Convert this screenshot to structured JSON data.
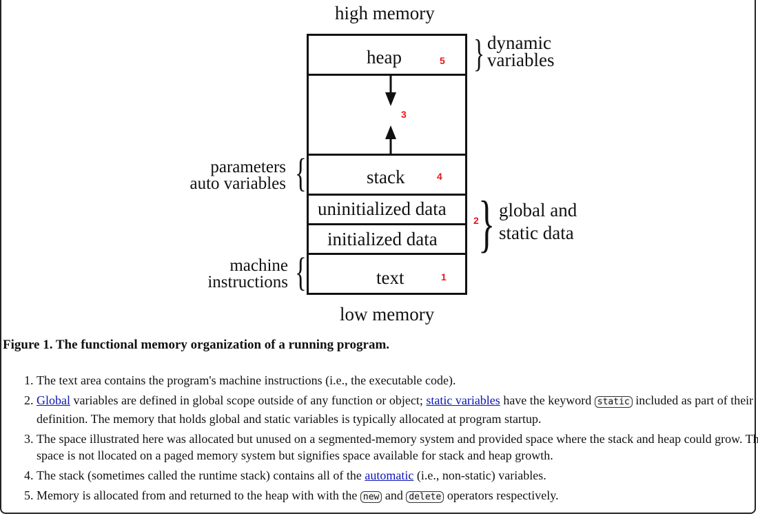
{
  "diagram": {
    "top_label": "high memory",
    "bottom_label": "low memory",
    "segments": [
      {
        "name": "heap",
        "number": "5"
      },
      {
        "name": "",
        "number": "3"
      },
      {
        "name": "stack",
        "number": "4"
      },
      {
        "name": "uninitialized data",
        "number": ""
      },
      {
        "name": "initialized data",
        "number": ""
      },
      {
        "name": "text",
        "number": "1"
      }
    ],
    "group_number_data": "2",
    "annotations": {
      "dynamic": [
        "dynamic",
        "variables"
      ],
      "params": [
        "parameters",
        "auto variables"
      ],
      "global": [
        "global and",
        "static data"
      ],
      "machine": [
        "machine",
        "instructions"
      ]
    }
  },
  "caption": "Figure 1. The functional memory organization of a running program.",
  "notes": [
    {
      "text": "The text area contains the program's machine instructions (i.e., the executable code)."
    },
    {
      "link1": "Global",
      "t1": " variables are defined in global scope outside of any function or object; ",
      "link2": "static variables",
      "t2": " have the keyword ",
      "code": "static",
      "t3": " included as part of their definition. The memory that holds global and static variables is typically allocated at program startup."
    },
    {
      "text": "The space illustrated here was allocated but unused on a segmented-memory system and provided space where the stack and heap could grow. This space is not llocated on a paged memory system but signifies space available for stack and heap growth."
    },
    {
      "t1": "The stack (sometimes called the runtime stack) contains all of the ",
      "link": "automatic",
      "t2": " (i.e., non-static) variables."
    },
    {
      "t1": "Memory is allocated from and returned to the heap with with the ",
      "code1": "new",
      "t2": " and ",
      "code2": "delete",
      "t3": " operators respectively."
    }
  ],
  "colors": {
    "number_red": "#e8131b",
    "link": "#0b14b5"
  }
}
